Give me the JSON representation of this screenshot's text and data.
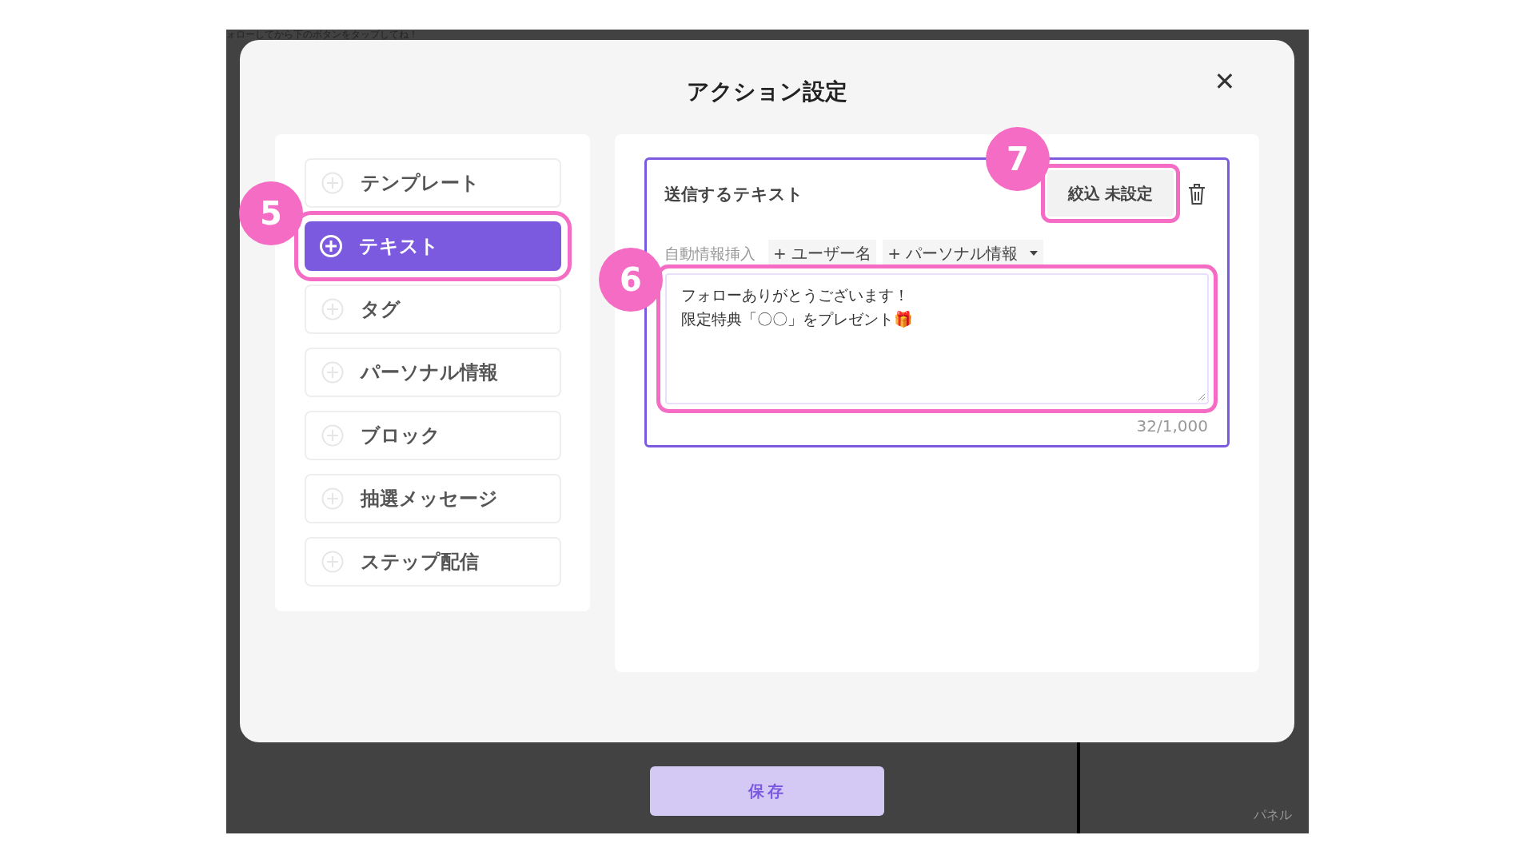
{
  "background": {
    "top_text": "ォローしてから下のボタンをタップしてね！",
    "bottom_right_text": "パネル"
  },
  "dialog": {
    "title": "アクション設定",
    "close": "✕"
  },
  "actions": [
    {
      "label": "テンプレート",
      "selected": false
    },
    {
      "label": "テキスト",
      "selected": true,
      "annotation": "5"
    },
    {
      "label": "タグ",
      "selected": false
    },
    {
      "label": "パーソナル情報",
      "selected": false
    },
    {
      "label": "ブロック",
      "selected": false
    },
    {
      "label": "抽選メッセージ",
      "selected": false
    },
    {
      "label": "ステップ配信",
      "selected": false
    }
  ],
  "text_card": {
    "title": "送信するテキスト",
    "filter_button": "絞込 未設定",
    "filter_annotation": "7",
    "insert_label": "自動情報挿入",
    "insert_chips": [
      {
        "label": "+ ユーザー名",
        "dropdown": false
      },
      {
        "label": "+ パーソナル情報",
        "dropdown": true
      }
    ],
    "message_lines": [
      "フォローありがとうございます！",
      "限定特典「〇〇」をプレゼント🎁"
    ],
    "message_annotation": "6",
    "counter": "32/1,000"
  },
  "save_button": "保存"
}
